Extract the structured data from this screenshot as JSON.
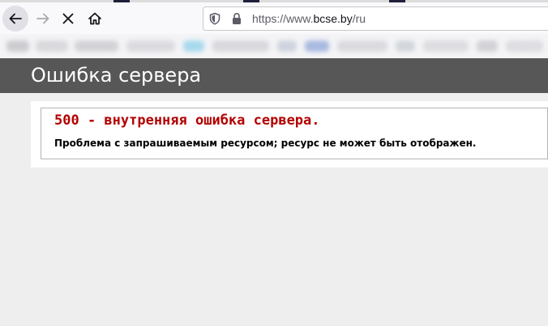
{
  "browser": {
    "url_prefix": "https://www.",
    "url_host": "bcse.by",
    "url_path": "/ru",
    "icons": [
      "back-arrow-icon",
      "forward-arrow-icon",
      "stop-loading-icon",
      "home-icon",
      "tracking-shield-icon",
      "padlock-icon"
    ]
  },
  "page": {
    "title": "Ошибка сервера",
    "error_heading": "500 - внутренняя ошибка сервера.",
    "error_message": "Проблема с запрашиваемым ресурсом; ресурс не может быть отображен."
  },
  "colors": {
    "header_bg": "#575757",
    "error_red": "#b30000",
    "page_bg": "#eeeeee"
  }
}
